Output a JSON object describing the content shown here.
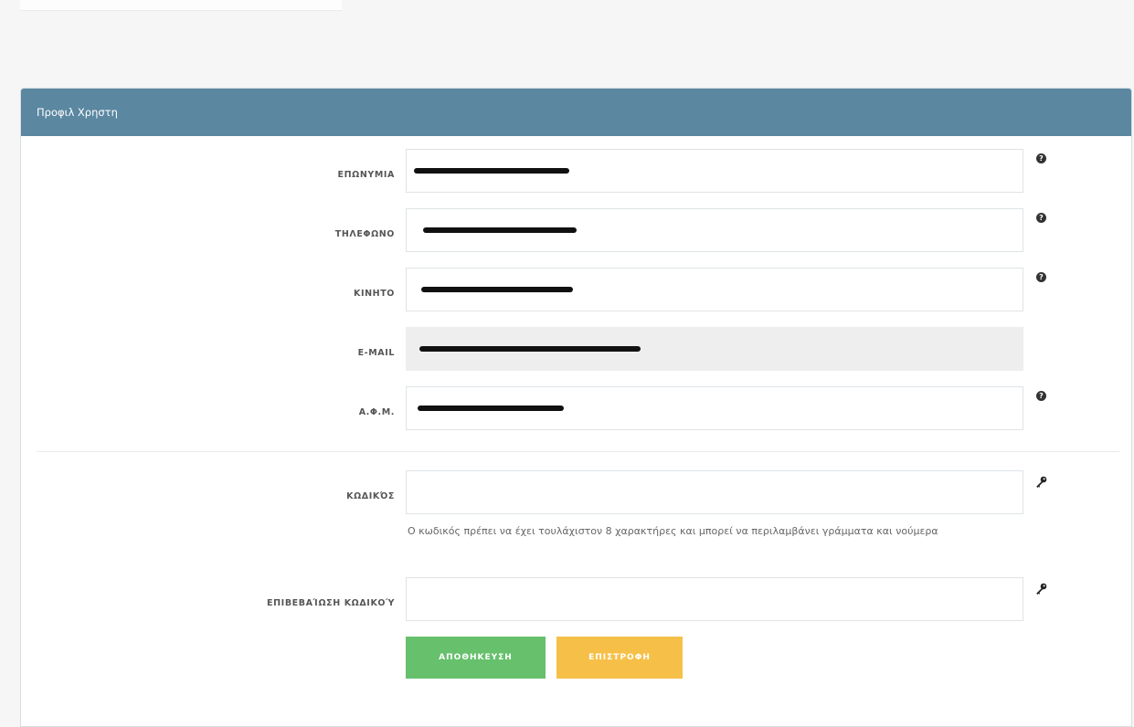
{
  "panel": {
    "title": "Προφιλ Χρηστη"
  },
  "fields": [
    {
      "label": "ΕΠΩΝΥΜΙΑ",
      "readonly": false,
      "icon": "question-circle-icon"
    },
    {
      "label": "ΤΗΛΕΦΩΝΟ",
      "readonly": false,
      "icon": "question-circle-icon"
    },
    {
      "label": "ΚΙΝΗΤΟ",
      "readonly": false,
      "icon": "question-circle-icon"
    },
    {
      "label": "E-MAIL",
      "readonly": true,
      "icon": ""
    },
    {
      "label": "Α.Φ.Μ.",
      "readonly": false,
      "icon": "question-circle-icon"
    }
  ],
  "password": {
    "label": "ΚΩΔΙΚΌΣ",
    "icon": "key-icon",
    "hint": "Ο κωδικός πρέπει να έχει τουλάχιστον 8 χαρακτήρες και μπορεί να περιλαμβάνει γράμματα και νούμερα"
  },
  "confirm_password": {
    "label": "ΕΠΙΒΕΒΑΊΩΣΗ ΚΩΔΙΚΟΎ",
    "icon": "key-icon"
  },
  "buttons": {
    "save_label": "ΑΠΟΘΗΚΕΥΣΗ",
    "back_label": "ΕΠΙΣΤΡΟΦΗ"
  },
  "colors": {
    "header": "#5b87a1",
    "save": "#66c06c",
    "back": "#f6c048"
  }
}
